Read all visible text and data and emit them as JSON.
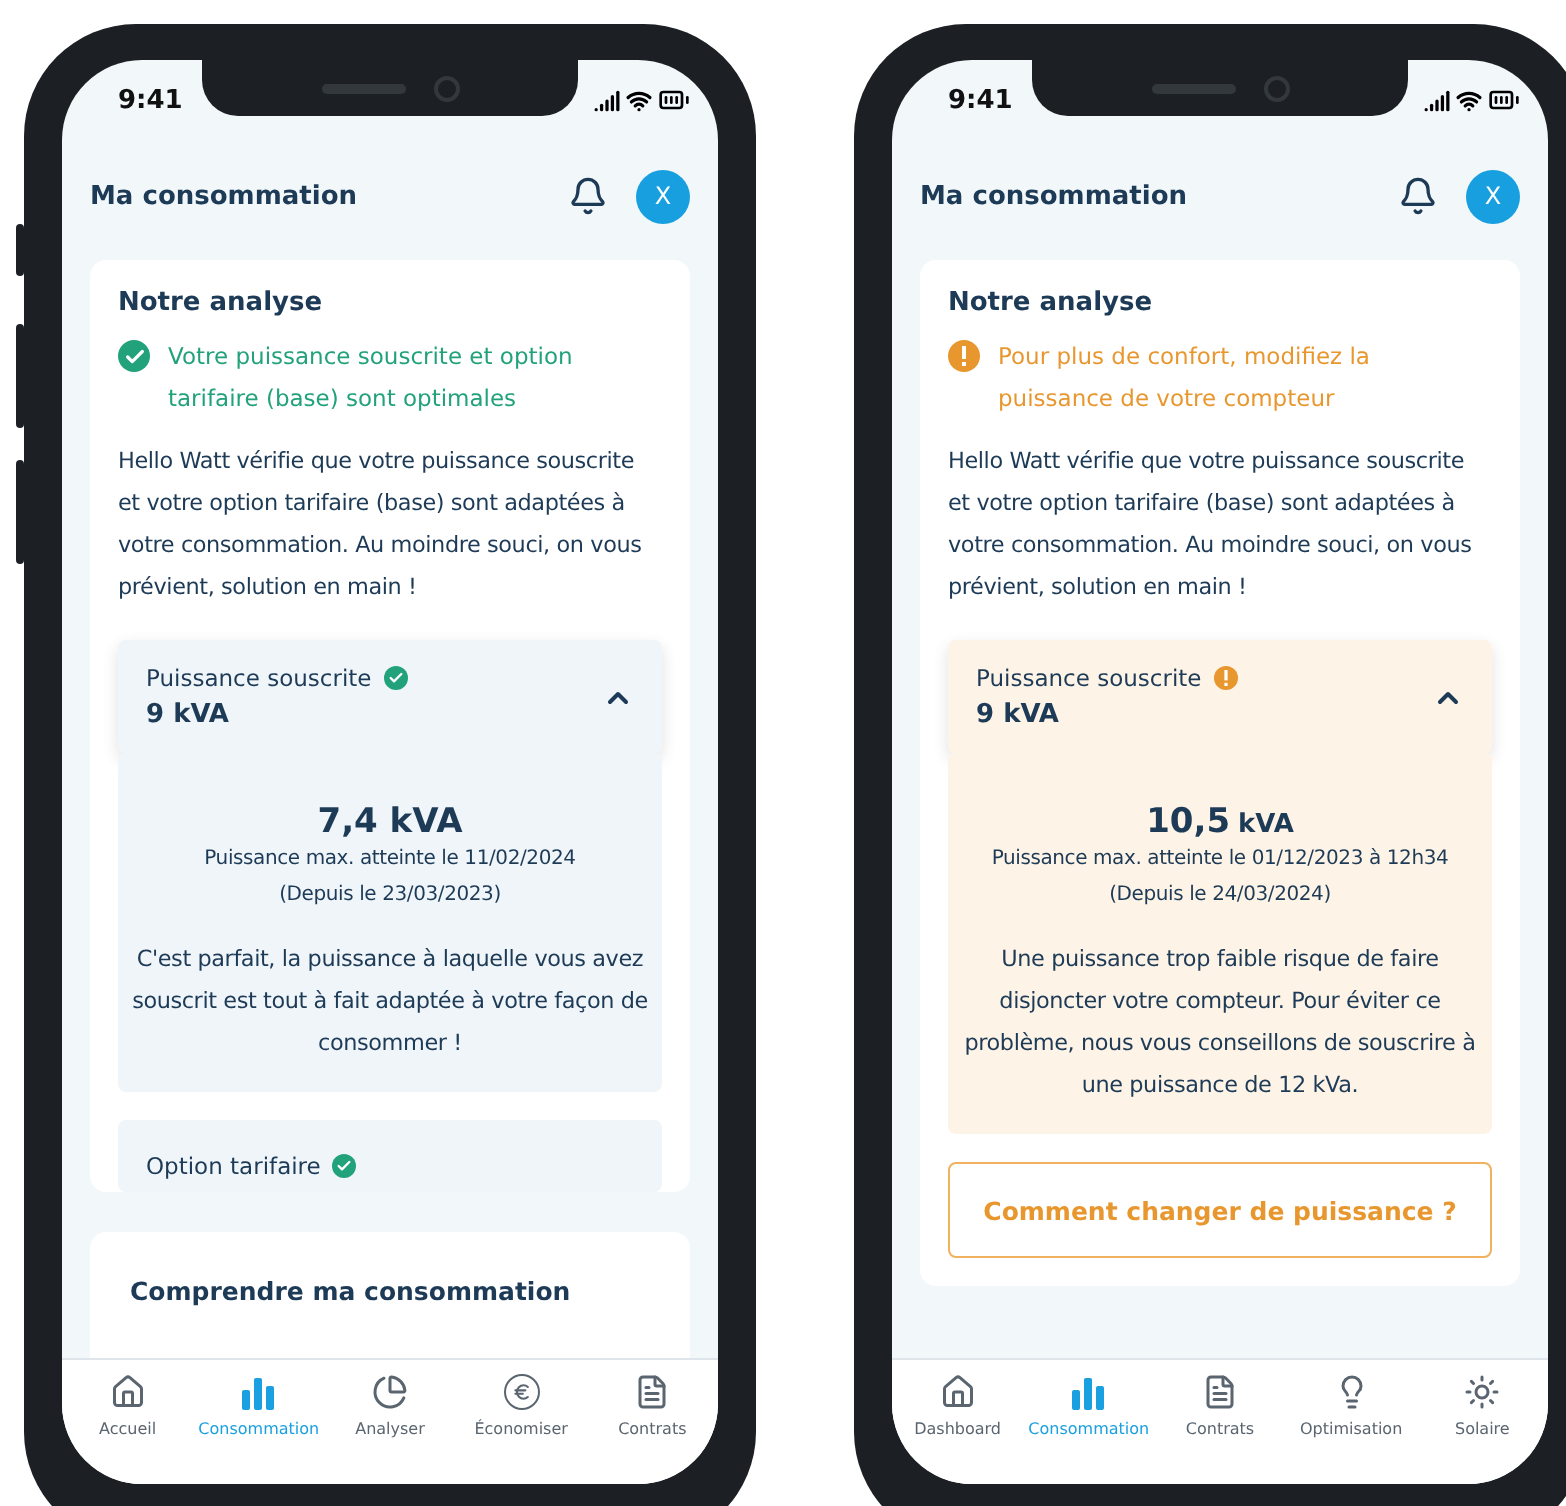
{
  "phones": [
    {
      "time": "9:41",
      "header": {
        "title": "Ma consommation",
        "avatar": "X"
      },
      "analysis": {
        "title": "Notre analyse",
        "kind": "ok",
        "headline": "Votre puissance souscrite et option tarifaire (base) sont optimales",
        "body": "Hello Watt vérifie que votre puissance souscrite et votre option tarifaire (base) sont adaptées à votre consommation. Au moindre souci, on vous prévient, solution en main !"
      },
      "power": {
        "label": "Puissance souscrite",
        "kind": "ok",
        "value": "9 kVA",
        "expanded": true,
        "max_value": "7,4 kVA",
        "max_date": "Puissance max. atteinte le 11/02/2024",
        "since": "(Depuis le 23/03/2023)",
        "message": "C'est parfait, la puissance à laquelle vous avez souscrit est tout à fait adaptée à votre façon de consommer !"
      },
      "option": {
        "label": "Option tarifaire",
        "kind": "ok"
      },
      "next_card": {
        "title": "Comprendre ma consommation"
      },
      "tabs": [
        {
          "label": "Accueil",
          "kind": "home",
          "selected": false
        },
        {
          "label": "Consommation",
          "kind": "bars",
          "selected": true
        },
        {
          "label": "Analyser",
          "kind": "pie",
          "selected": false
        },
        {
          "label": "Économiser",
          "kind": "euro",
          "selected": false
        },
        {
          "label": "Contrats",
          "kind": "document",
          "selected": false
        }
      ]
    },
    {
      "time": "9:41",
      "header": {
        "title": "Ma consommation",
        "avatar": "X"
      },
      "analysis": {
        "title": "Notre analyse",
        "kind": "warning",
        "headline": "Pour plus de confort, modifiez la puissance de votre compteur",
        "body": "Hello Watt vérifie que votre puissance souscrite et votre option tarifaire (base) sont adaptées à votre consommation. Au moindre souci, on vous prévient, solution en main !"
      },
      "power": {
        "label": "Puissance souscrite",
        "kind": "warning",
        "value": "9 kVA",
        "expanded": true,
        "max_value": "10,5",
        "max_unit": "kVA",
        "max_date": "Puissance max. atteinte le 01/12/2023 à 12h34",
        "since": "(Depuis le 24/03/2024)",
        "message": "Une puissance trop faible risque de faire disjoncter votre compteur. Pour éviter ce problème, nous vous conseillons de souscrire à une puissance de 12 kVa."
      },
      "button": {
        "label": "Comment changer de puissance ?"
      },
      "tabs": [
        {
          "label": "Dashboard",
          "kind": "home",
          "selected": false
        },
        {
          "label": "Consommation",
          "kind": "bars",
          "selected": true
        },
        {
          "label": "Contrats",
          "kind": "document",
          "selected": false
        },
        {
          "label": "Optimisation",
          "kind": "bulb",
          "selected": false
        },
        {
          "label": "Solaire",
          "kind": "sun",
          "selected": false
        }
      ]
    }
  ]
}
